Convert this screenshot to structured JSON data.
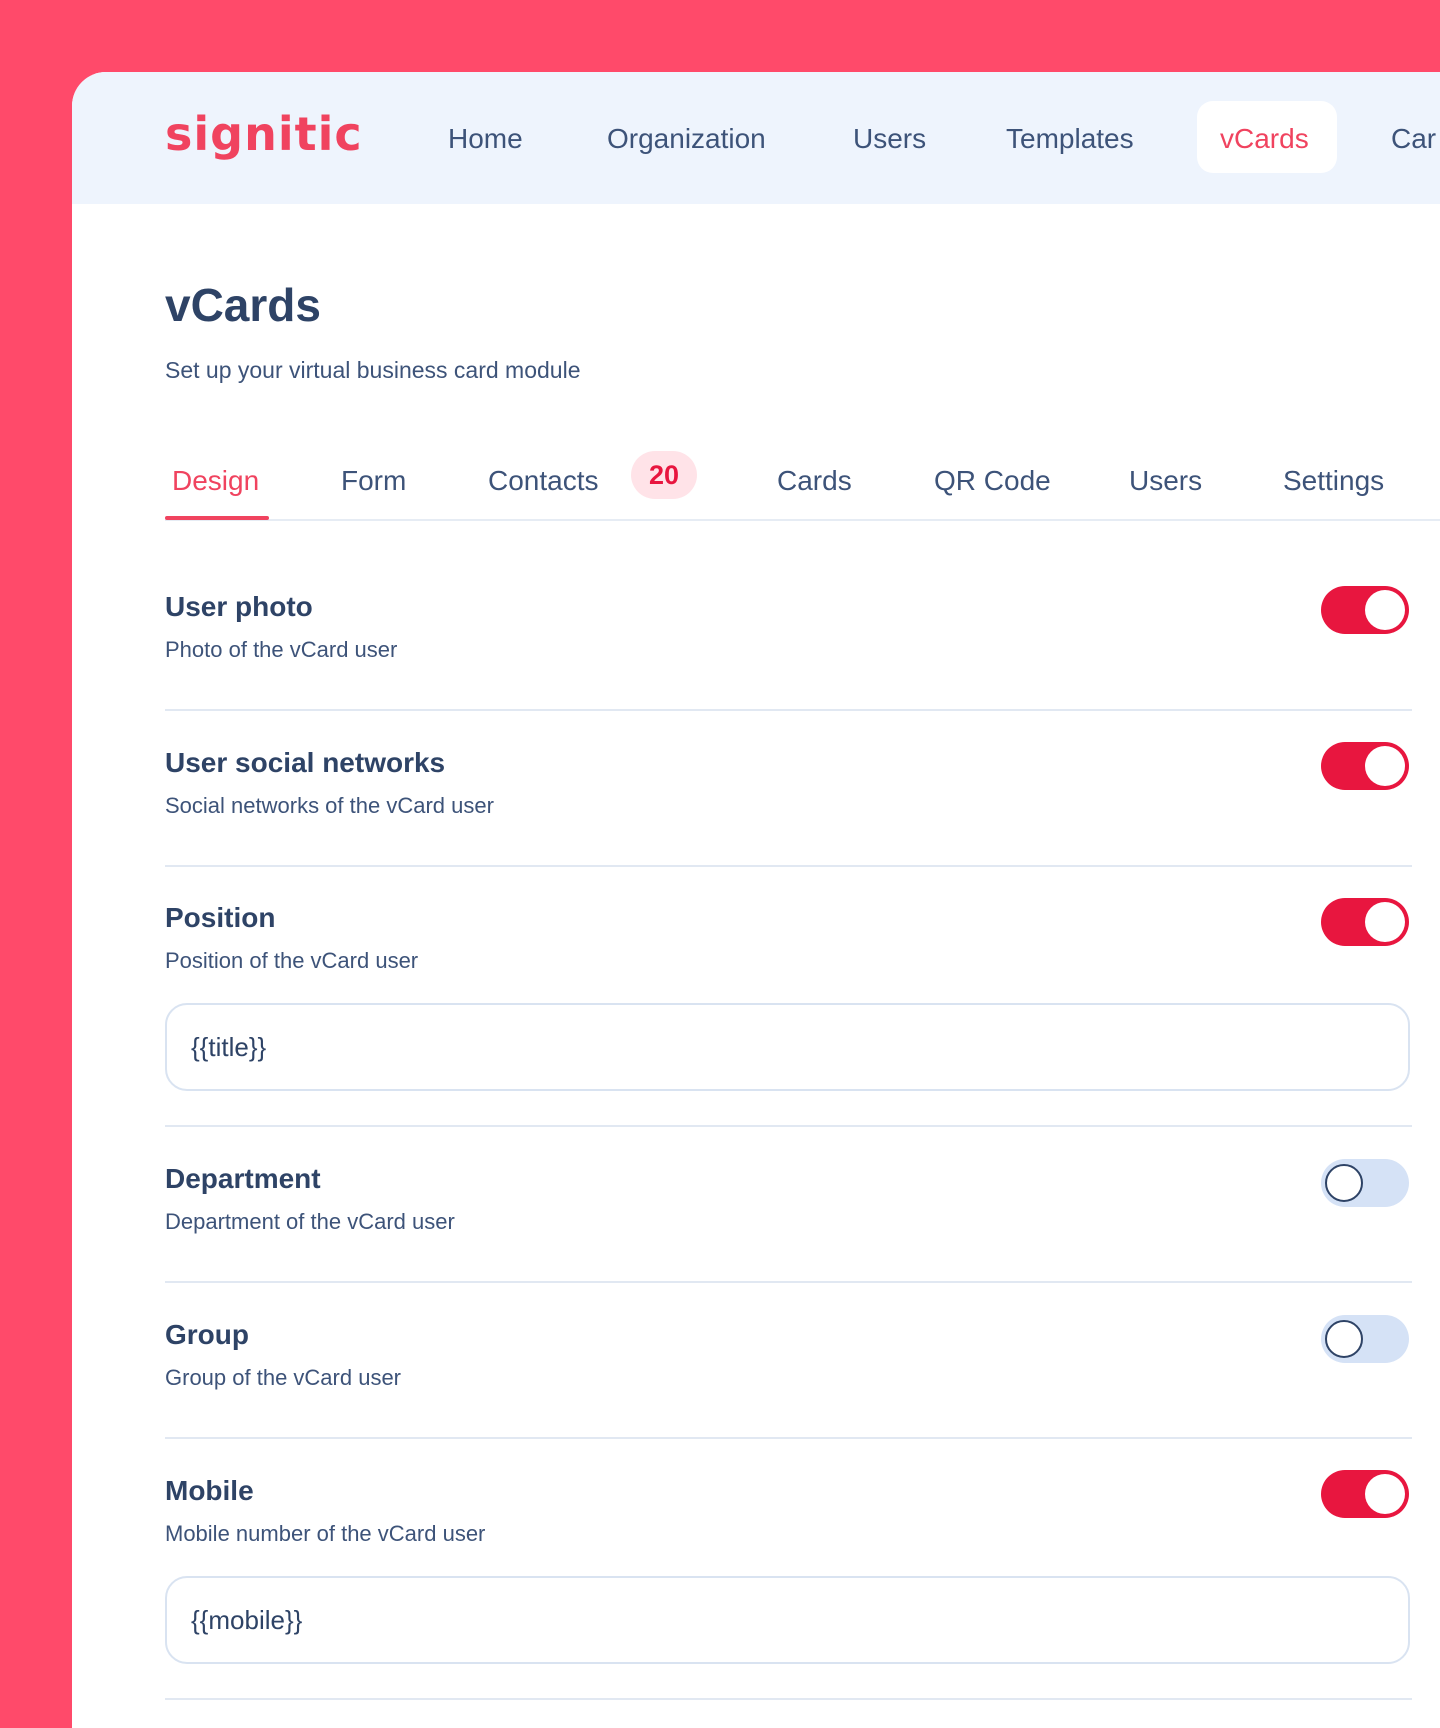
{
  "brand": {
    "logo_text": "signitic",
    "accent_color": "#f0435f",
    "background_color": "#ff4a6a"
  },
  "topnav": {
    "items": [
      {
        "label": "Home"
      },
      {
        "label": "Organization"
      },
      {
        "label": "Users"
      },
      {
        "label": "Templates"
      },
      {
        "label": "vCards",
        "active": true
      },
      {
        "label": "Car"
      }
    ]
  },
  "page": {
    "title": "vCards",
    "subtitle": "Set up your virtual business card module"
  },
  "tabs": {
    "items": [
      {
        "label": "Design",
        "active": true
      },
      {
        "label": "Form"
      },
      {
        "label": "Contacts",
        "badge": "20"
      },
      {
        "label": "Cards"
      },
      {
        "label": "QR Code"
      },
      {
        "label": "Users"
      },
      {
        "label": "Settings"
      }
    ]
  },
  "settings": {
    "rows": [
      {
        "title": "User photo",
        "description": "Photo of the vCard user",
        "enabled": true
      },
      {
        "title": "User social networks",
        "description": "Social networks of the vCard user",
        "enabled": true
      },
      {
        "title": "Position",
        "description": "Position of the vCard user",
        "enabled": true,
        "input_value": "{{title}}"
      },
      {
        "title": "Department",
        "description": "Department of the vCard user",
        "enabled": false
      },
      {
        "title": "Group",
        "description": "Group of the vCard user",
        "enabled": false
      },
      {
        "title": "Mobile",
        "description": "Mobile number of the vCard user",
        "enabled": true,
        "input_value": "{{mobile}}"
      }
    ]
  }
}
